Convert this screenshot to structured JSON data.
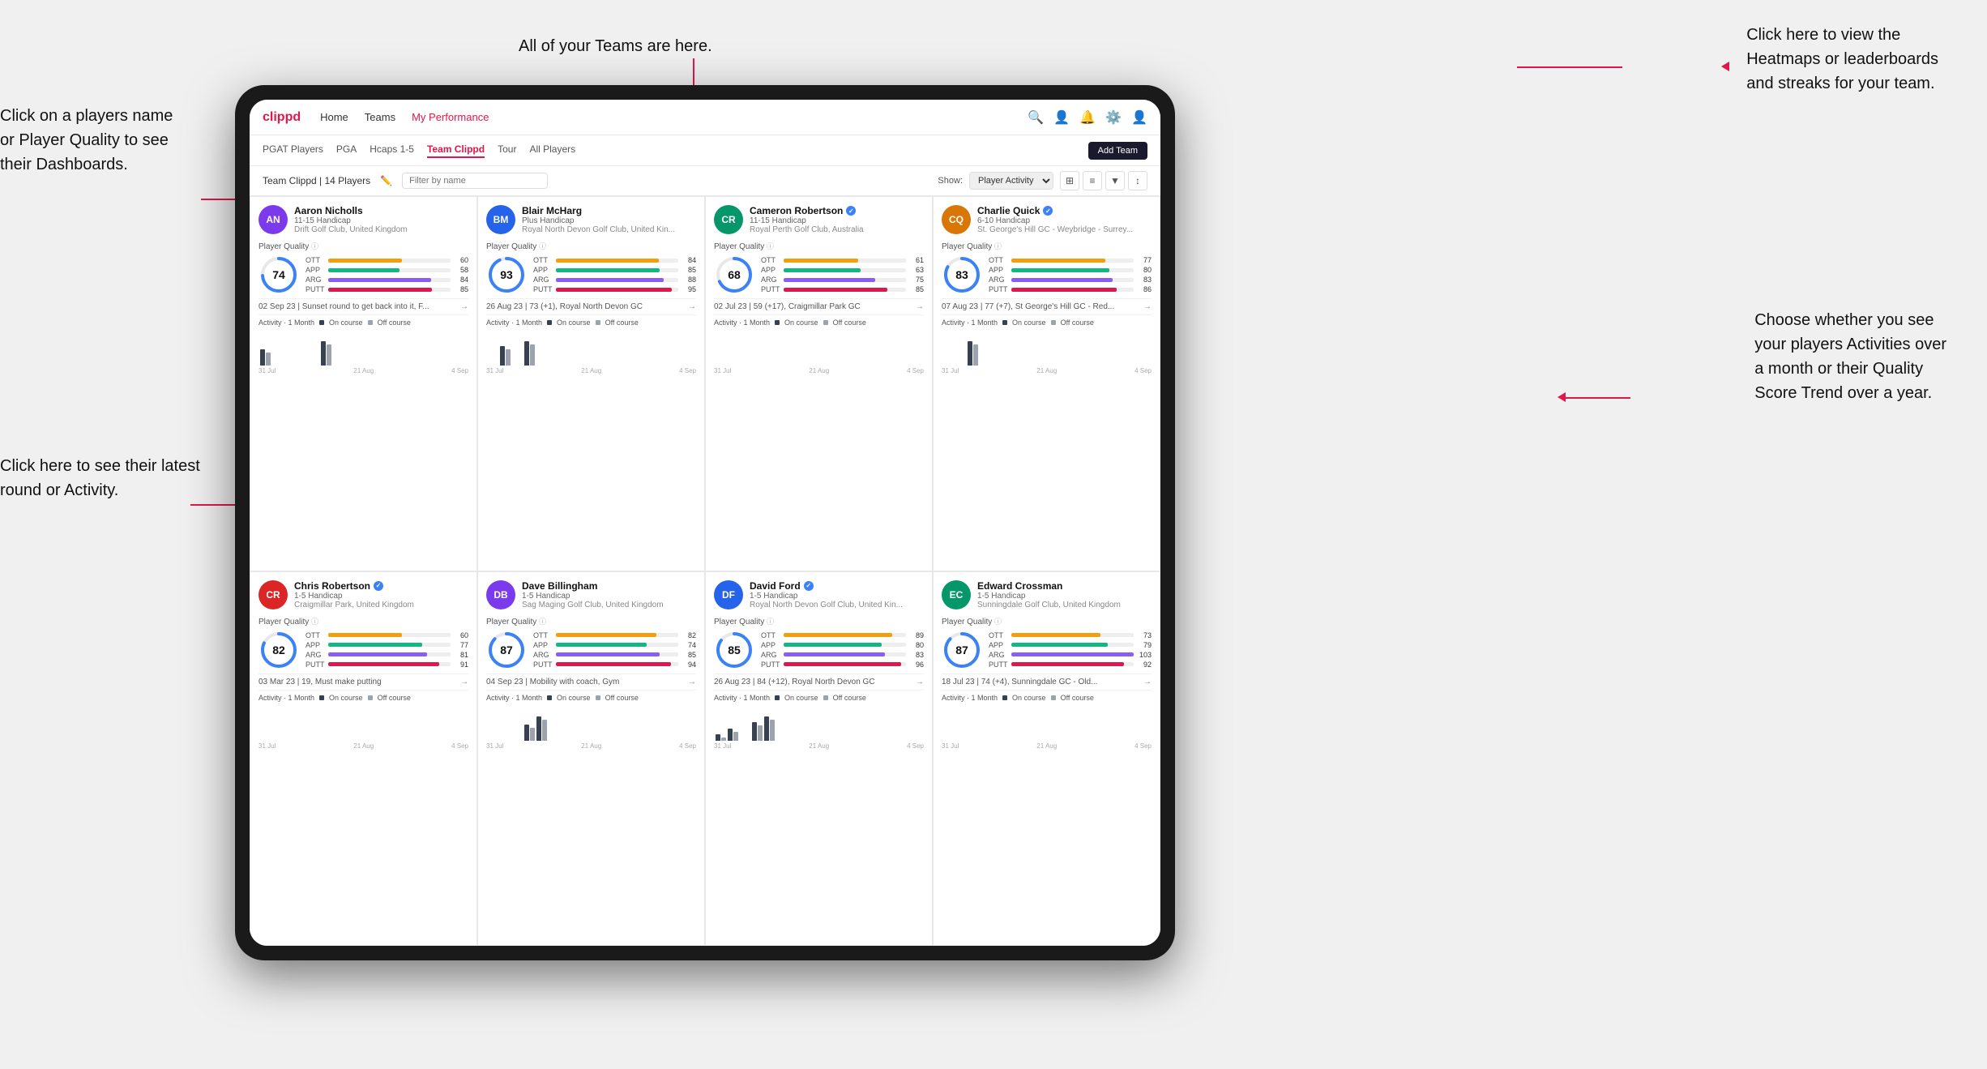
{
  "annotations": {
    "top_center": "All of your Teams are here.",
    "top_right_title": "Click here to view the",
    "top_right_line2": "Heatmaps or leaderboards",
    "top_right_line3": "and streaks for your team.",
    "left_top_title": "Click on a players name",
    "left_top_line2": "or Player Quality to see",
    "left_top_line3": "their Dashboards.",
    "left_bottom_title": "Click here to see their latest",
    "left_bottom_line2": "round or Activity.",
    "bottom_right_title": "Choose whether you see",
    "bottom_right_line2": "your players Activities over",
    "bottom_right_line3": "a month or their Quality",
    "bottom_right_line4": "Score Trend over a year."
  },
  "nav": {
    "logo": "clippd",
    "links": [
      "Home",
      "Teams",
      "My Performance"
    ],
    "active_link": "Teams"
  },
  "sub_nav": {
    "links": [
      "PGAT Players",
      "PGA",
      "Hcaps 1-5",
      "Team Clippd",
      "Tour",
      "All Players"
    ],
    "active_link": "Team Clippd",
    "add_team_label": "Add Team"
  },
  "team_bar": {
    "title": "Team Clippd | 14 Players",
    "search_placeholder": "Filter by name",
    "show_label": "Show:",
    "show_value": "Player Activity",
    "view_icons": [
      "grid-2",
      "grid-3",
      "filter",
      "sort"
    ]
  },
  "players": [
    {
      "name": "Aaron Nicholls",
      "handicap": "11-15 Handicap",
      "club": "Drift Golf Club, United Kingdom",
      "verified": false,
      "quality": 74,
      "quality_color": "#3b82f6",
      "bars": [
        {
          "label": "OTT",
          "value": 60,
          "color": "#f59e0b"
        },
        {
          "label": "APP",
          "value": 58,
          "color": "#10b981"
        },
        {
          "label": "ARG",
          "value": 84,
          "color": "#8b5cf6"
        },
        {
          "label": "PUTT",
          "value": 85,
          "color": "#e0174a"
        }
      ],
      "latest": "02 Sep 23 | Sunset round to get back into it, F...",
      "activity_label": "Activity · 1 Month",
      "bars_data": [
        2,
        0,
        0,
        0,
        0,
        3,
        0
      ],
      "x_labels": [
        "31 Jul",
        "21 Aug",
        "4 Sep"
      ]
    },
    {
      "name": "Blair McHarg",
      "handicap": "Plus Handicap",
      "club": "Royal North Devon Golf Club, United Kin...",
      "verified": false,
      "quality": 93,
      "quality_color": "#3b82f6",
      "bars": [
        {
          "label": "OTT",
          "value": 84,
          "color": "#f59e0b"
        },
        {
          "label": "APP",
          "value": 85,
          "color": "#10b981"
        },
        {
          "label": "ARG",
          "value": 88,
          "color": "#8b5cf6"
        },
        {
          "label": "PUTT",
          "value": 95,
          "color": "#e0174a"
        }
      ],
      "latest": "26 Aug 23 | 73 (+1), Royal North Devon GC",
      "activity_label": "Activity · 1 Month",
      "bars_data": [
        0,
        4,
        0,
        5,
        0,
        0,
        0
      ],
      "x_labels": [
        "31 Jul",
        "21 Aug",
        "4 Sep"
      ]
    },
    {
      "name": "Cameron Robertson",
      "handicap": "11-15 Handicap",
      "club": "Royal Perth Golf Club, Australia",
      "verified": true,
      "quality": 68,
      "quality_color": "#3b82f6",
      "bars": [
        {
          "label": "OTT",
          "value": 61,
          "color": "#f59e0b"
        },
        {
          "label": "APP",
          "value": 63,
          "color": "#10b981"
        },
        {
          "label": "ARG",
          "value": 75,
          "color": "#8b5cf6"
        },
        {
          "label": "PUTT",
          "value": 85,
          "color": "#e0174a"
        }
      ],
      "latest": "02 Jul 23 | 59 (+17), Craigmillar Park GC",
      "activity_label": "Activity · 1 Month",
      "bars_data": [
        0,
        0,
        0,
        0,
        0,
        0,
        0
      ],
      "x_labels": [
        "31 Jul",
        "21 Aug",
        "4 Sep"
      ]
    },
    {
      "name": "Charlie Quick",
      "handicap": "6-10 Handicap",
      "club": "St. George's Hill GC - Weybridge - Surrey...",
      "verified": true,
      "quality": 83,
      "quality_color": "#3b82f6",
      "bars": [
        {
          "label": "OTT",
          "value": 77,
          "color": "#f59e0b"
        },
        {
          "label": "APP",
          "value": 80,
          "color": "#10b981"
        },
        {
          "label": "ARG",
          "value": 83,
          "color": "#8b5cf6"
        },
        {
          "label": "PUTT",
          "value": 86,
          "color": "#e0174a"
        }
      ],
      "latest": "07 Aug 23 | 77 (+7), St George's Hill GC - Red...",
      "activity_label": "Activity · 1 Month",
      "bars_data": [
        0,
        0,
        3,
        0,
        0,
        0,
        0
      ],
      "x_labels": [
        "31 Jul",
        "21 Aug",
        "4 Sep"
      ]
    },
    {
      "name": "Chris Robertson",
      "handicap": "1-5 Handicap",
      "club": "Craigmillar Park, United Kingdom",
      "verified": true,
      "quality": 82,
      "quality_color": "#3b82f6",
      "bars": [
        {
          "label": "OTT",
          "value": 60,
          "color": "#f59e0b"
        },
        {
          "label": "APP",
          "value": 77,
          "color": "#10b981"
        },
        {
          "label": "ARG",
          "value": 81,
          "color": "#8b5cf6"
        },
        {
          "label": "PUTT",
          "value": 91,
          "color": "#e0174a"
        }
      ],
      "latest": "03 Mar 23 | 19, Must make putting",
      "activity_label": "Activity · 1 Month",
      "bars_data": [
        0,
        0,
        0,
        0,
        0,
        0,
        0
      ],
      "x_labels": [
        "31 Jul",
        "21 Aug",
        "4 Sep"
      ]
    },
    {
      "name": "Dave Billingham",
      "handicap": "1-5 Handicap",
      "club": "Sag Maging Golf Club, United Kingdom",
      "verified": false,
      "quality": 87,
      "quality_color": "#3b82f6",
      "bars": [
        {
          "label": "OTT",
          "value": 82,
          "color": "#f59e0b"
        },
        {
          "label": "APP",
          "value": 74,
          "color": "#10b981"
        },
        {
          "label": "ARG",
          "value": 85,
          "color": "#8b5cf6"
        },
        {
          "label": "PUTT",
          "value": 94,
          "color": "#e0174a"
        }
      ],
      "latest": "04 Sep 23 | Mobility with coach, Gym",
      "activity_label": "Activity · 1 Month",
      "bars_data": [
        0,
        0,
        0,
        2,
        3,
        0,
        0
      ],
      "x_labels": [
        "31 Jul",
        "21 Aug",
        "4 Sep"
      ]
    },
    {
      "name": "David Ford",
      "handicap": "1-5 Handicap",
      "club": "Royal North Devon Golf Club, United Kin...",
      "verified": true,
      "quality": 85,
      "quality_color": "#3b82f6",
      "bars": [
        {
          "label": "OTT",
          "value": 89,
          "color": "#f59e0b"
        },
        {
          "label": "APP",
          "value": 80,
          "color": "#10b981"
        },
        {
          "label": "ARG",
          "value": 83,
          "color": "#8b5cf6"
        },
        {
          "label": "PUTT",
          "value": 96,
          "color": "#e0174a"
        }
      ],
      "latest": "26 Aug 23 | 84 (+12), Royal North Devon GC",
      "activity_label": "Activity · 1 Month",
      "bars_data": [
        2,
        4,
        0,
        6,
        8,
        0,
        0
      ],
      "x_labels": [
        "31 Jul",
        "21 Aug",
        "4 Sep"
      ]
    },
    {
      "name": "Edward Crossman",
      "handicap": "1-5 Handicap",
      "club": "Sunningdale Golf Club, United Kingdom",
      "verified": false,
      "quality": 87,
      "quality_color": "#3b82f6",
      "bars": [
        {
          "label": "OTT",
          "value": 73,
          "color": "#f59e0b"
        },
        {
          "label": "APP",
          "value": 79,
          "color": "#10b981"
        },
        {
          "label": "ARG",
          "value": 103,
          "color": "#8b5cf6"
        },
        {
          "label": "PUTT",
          "value": 92,
          "color": "#e0174a"
        }
      ],
      "latest": "18 Jul 23 | 74 (+4), Sunningdale GC - Old...",
      "activity_label": "Activity · 1 Month",
      "bars_data": [
        0,
        0,
        0,
        0,
        0,
        0,
        0
      ],
      "x_labels": [
        "31 Jul",
        "21 Aug",
        "4 Sep"
      ]
    }
  ]
}
